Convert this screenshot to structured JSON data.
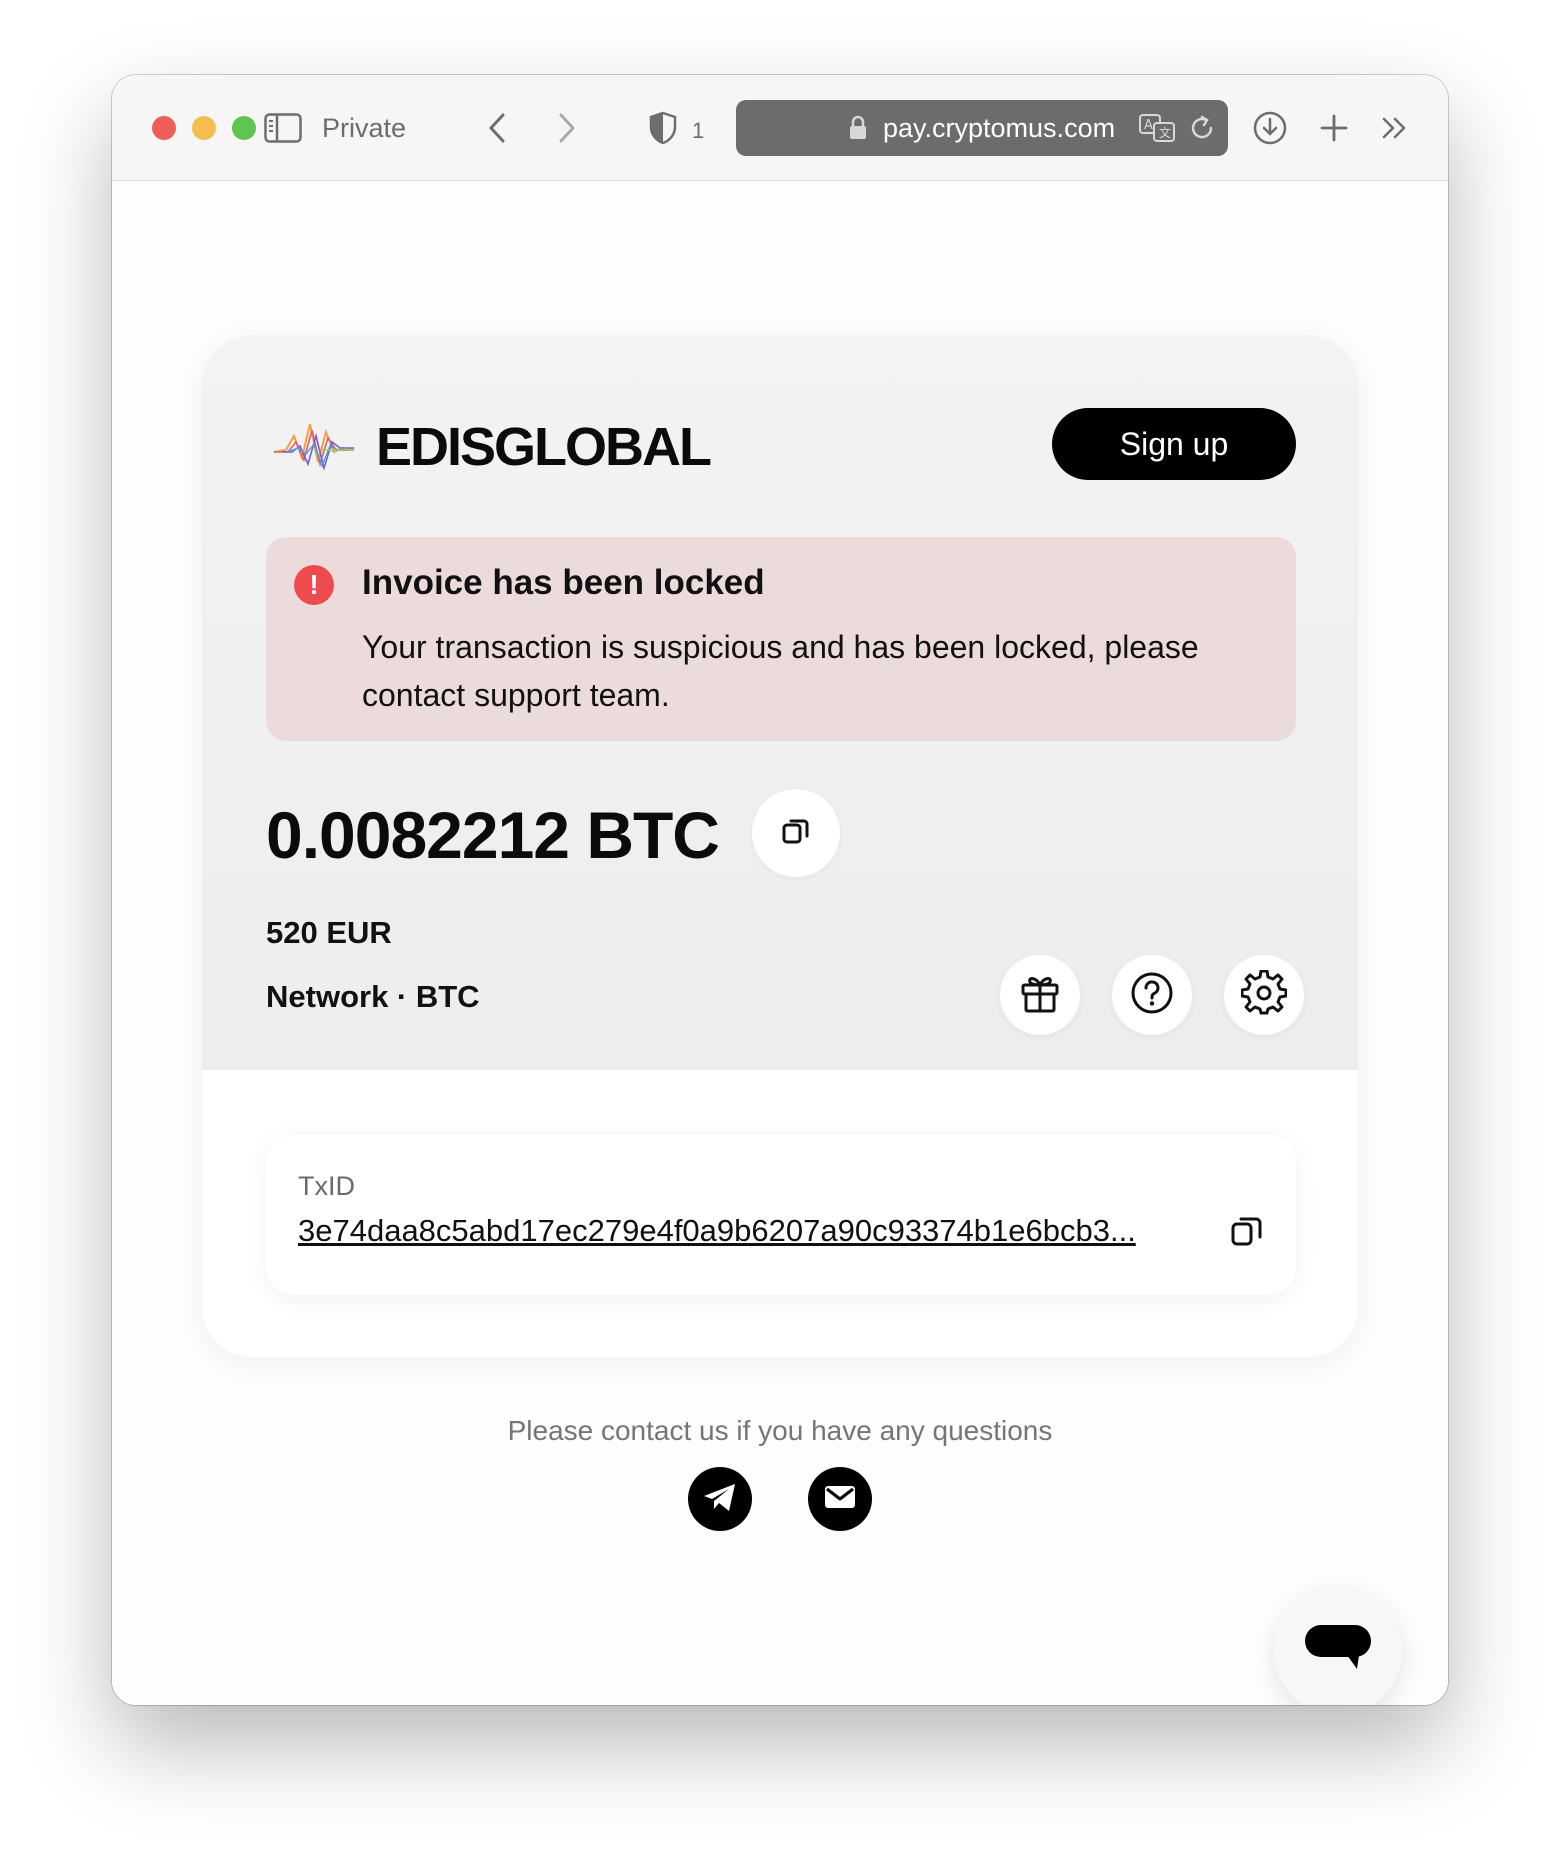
{
  "browser": {
    "private_label": "Private",
    "tracker_count": "1",
    "url": "pay.cryptomus.com"
  },
  "merchant": {
    "name": "EDISGLOBAL",
    "logo_colors": [
      "#f1a23c",
      "#e85b6a",
      "#7b5bd6",
      "#3aa5e0",
      "#a8c84a"
    ]
  },
  "header": {
    "signup_label": "Sign up"
  },
  "alert": {
    "title": "Invoice has been locked",
    "message": "Your transaction is suspicious and has been locked, please contact support team.",
    "icon": "exclamation-icon",
    "color": "#ee4b4f",
    "background": "#ecdbdb"
  },
  "payment": {
    "amount": "0.0082212 BTC",
    "fiat": "520 EUR",
    "network": "Network · BTC"
  },
  "transaction": {
    "label": "TxID",
    "txid": "3e74daa8c5abd17ec279e4f0a9b6207a90c93374b1e6bcb3..."
  },
  "footer": {
    "contact_text": "Please contact us if you have any questions"
  }
}
